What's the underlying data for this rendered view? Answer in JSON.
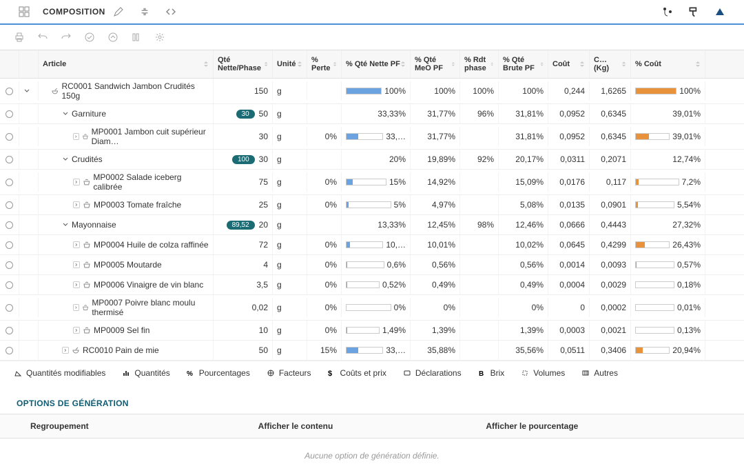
{
  "topbar": {
    "title": "COMPOSITION"
  },
  "columns": [
    "",
    "",
    "Article",
    "Qté Nette/Phase",
    "Unité",
    "% Perte",
    "% Qté Nette PF",
    "% Qté MeO PF",
    "% Rdt phase",
    "% Qté Brute PF",
    "Coût",
    "C… (Kg)",
    "% Coût"
  ],
  "rows": [
    {
      "lvl": 1,
      "chev": "down",
      "icon": "mortar",
      "label": "RC0001 Sandwich Jambon Crudités 150g",
      "qte": "150",
      "unit": "g",
      "perte": "",
      "nette": "100%",
      "meo": "100%",
      "rdt": "100%",
      "brute": "100%",
      "cout": "0,244",
      "ckg": "1,6265",
      "pcout": "100%",
      "barN": 100,
      "barC": 100
    },
    {
      "lvl": 2,
      "chev": "down",
      "label": "Garniture",
      "badge": "30",
      "qte": "50",
      "unit": "g",
      "perte": "",
      "nette": "33,33%",
      "meo": "31,77%",
      "rdt": "96%",
      "brute": "31,81%",
      "cout": "0,0952",
      "ckg": "0,6345",
      "pcout": "39,01%"
    },
    {
      "lvl": 3,
      "chev": "right",
      "icon": "ing",
      "label": "MP0001 Jambon cuit supérieur Diam…",
      "qte": "30",
      "unit": "g",
      "perte": "0%",
      "nette": "33,…",
      "meo": "31,77%",
      "rdt": "",
      "brute": "31,81%",
      "cout": "0,0952",
      "ckg": "0,6345",
      "pcout": "39,01%",
      "barN": 33,
      "barC": 39
    },
    {
      "lvl": 2,
      "chev": "down",
      "label": "Crudités",
      "badge": "100",
      "qte": "30",
      "unit": "g",
      "perte": "",
      "nette": "20%",
      "meo": "19,89%",
      "rdt": "92%",
      "brute": "20,17%",
      "cout": "0,0311",
      "ckg": "0,2071",
      "pcout": "12,74%"
    },
    {
      "lvl": 3,
      "chev": "right",
      "icon": "ing",
      "label": "MP0002 Salade iceberg calibrée",
      "qte": "75",
      "unit": "g",
      "perte": "0%",
      "nette": "15%",
      "meo": "14,92%",
      "rdt": "",
      "brute": "15,09%",
      "cout": "0,0176",
      "ckg": "0,117",
      "pcout": "7,2%",
      "barN": 15,
      "barC": 7
    },
    {
      "lvl": 3,
      "chev": "right",
      "icon": "ing",
      "label": "MP0003 Tomate fraîche",
      "qte": "25",
      "unit": "g",
      "perte": "0%",
      "nette": "5%",
      "meo": "4,97%",
      "rdt": "",
      "brute": "5,08%",
      "cout": "0,0135",
      "ckg": "0,0901",
      "pcout": "5,54%",
      "barN": 5,
      "barC": 6
    },
    {
      "lvl": 2,
      "chev": "down",
      "label": "Mayonnaise",
      "badge": "89,52",
      "qte": "20",
      "unit": "g",
      "perte": "",
      "nette": "13,33%",
      "meo": "12,45%",
      "rdt": "98%",
      "brute": "12,46%",
      "cout": "0,0666",
      "ckg": "0,4443",
      "pcout": "27,32%"
    },
    {
      "lvl": 3,
      "chev": "right",
      "icon": "ing",
      "label": "MP0004 Huile de colza raffinée",
      "qte": "72",
      "unit": "g",
      "perte": "0%",
      "nette": "10,…",
      "meo": "10,01%",
      "rdt": "",
      "brute": "10,02%",
      "cout": "0,0645",
      "ckg": "0,4299",
      "pcout": "26,43%",
      "barN": 10,
      "barC": 26
    },
    {
      "lvl": 3,
      "chev": "right",
      "icon": "ing",
      "label": "MP0005 Moutarde",
      "qte": "4",
      "unit": "g",
      "perte": "0%",
      "nette": "0,6%",
      "meo": "0,56%",
      "rdt": "",
      "brute": "0,56%",
      "cout": "0,0014",
      "ckg": "0,0093",
      "pcout": "0,57%",
      "barN": 1,
      "barC": 1
    },
    {
      "lvl": 3,
      "chev": "right",
      "icon": "ing",
      "label": "MP0006 Vinaigre de vin blanc",
      "qte": "3,5",
      "unit": "g",
      "perte": "0%",
      "nette": "0,52%",
      "meo": "0,49%",
      "rdt": "",
      "brute": "0,49%",
      "cout": "0,0004",
      "ckg": "0,0029",
      "pcout": "0,18%",
      "barN": 1,
      "barC": 0
    },
    {
      "lvl": 3,
      "chev": "right",
      "icon": "ing",
      "label": "MP0007 Poivre blanc moulu thermisé",
      "qte": "0,02",
      "unit": "g",
      "perte": "0%",
      "nette": "0%",
      "meo": "0%",
      "rdt": "",
      "brute": "0%",
      "cout": "0",
      "ckg": "0,0002",
      "pcout": "0,01%",
      "barN": 0,
      "barC": 0
    },
    {
      "lvl": 3,
      "chev": "right",
      "icon": "ing",
      "label": "MP0009 Sel fin",
      "qte": "10",
      "unit": "g",
      "perte": "0%",
      "nette": "1,49%",
      "meo": "1,39%",
      "rdt": "",
      "brute": "1,39%",
      "cout": "0,0003",
      "ckg": "0,0021",
      "pcout": "0,13%",
      "barN": 1,
      "barC": 0
    },
    {
      "lvl": 2,
      "chev": "right",
      "icon": "mortar",
      "label": "RC0010 Pain de mie",
      "qte": "50",
      "unit": "g",
      "perte": "15%",
      "nette": "33,…",
      "meo": "35,88%",
      "rdt": "",
      "brute": "35,56%",
      "cout": "0,0511",
      "ckg": "0,3406",
      "pcout": "20,94%",
      "barN": 33,
      "barC": 21
    }
  ],
  "footer_tabs": [
    "Quantités modifiables",
    "Quantités",
    "Pourcentages",
    "Facteurs",
    "Coûts et prix",
    "Déclarations",
    "Brix",
    "Volumes",
    "Autres"
  ],
  "options": {
    "title": "OPTIONS DE GÉNÉRATION",
    "cols": [
      "Regroupement",
      "Afficher le contenu",
      "Afficher le pourcentage"
    ],
    "empty": "Aucune option de génération définie."
  }
}
